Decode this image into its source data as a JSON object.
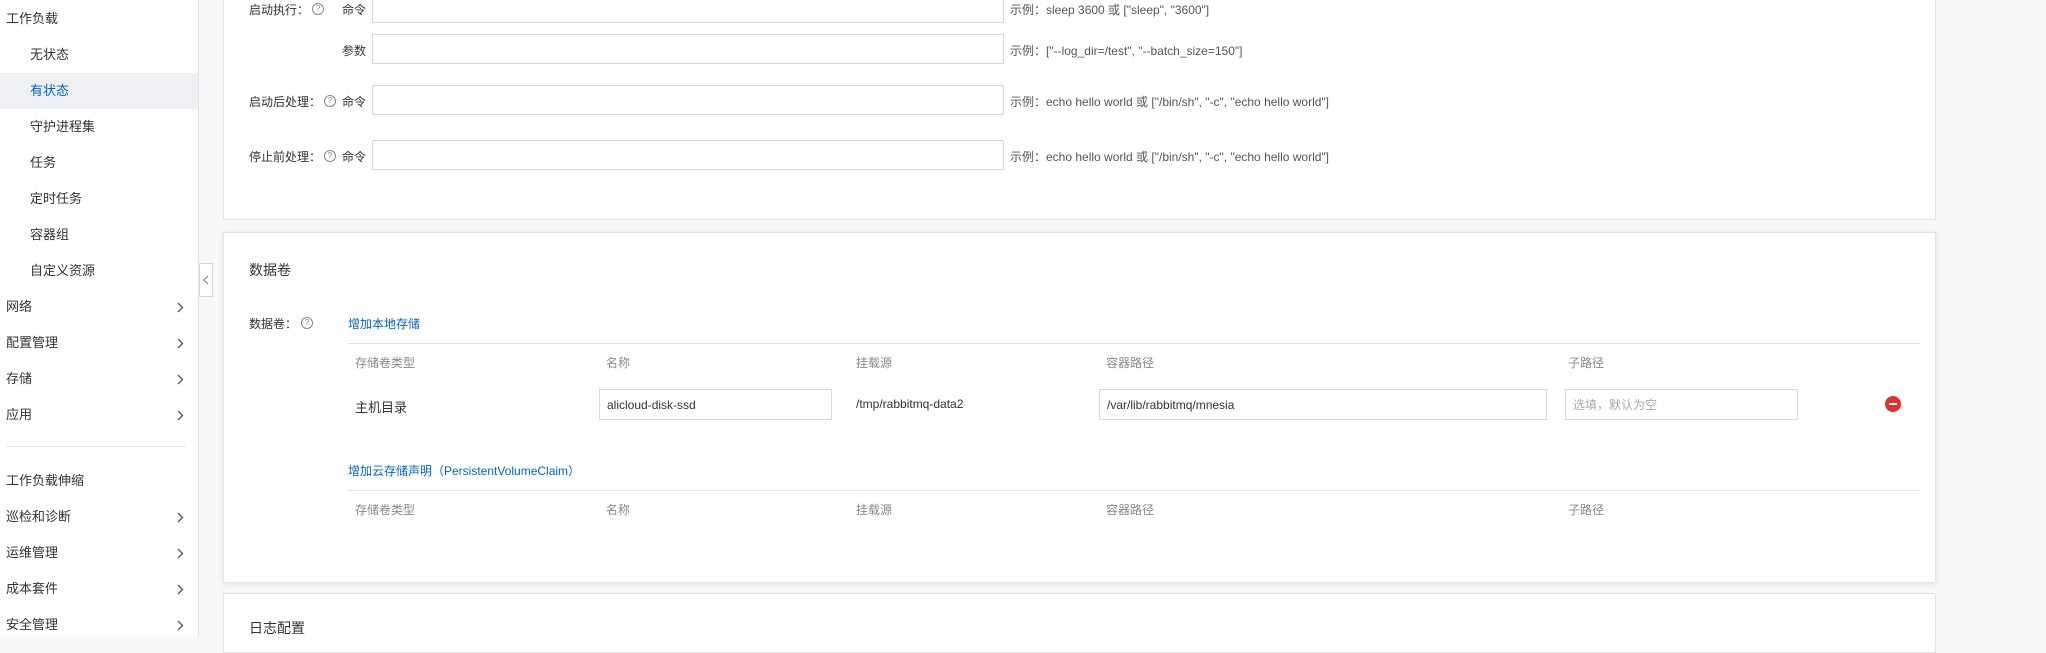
{
  "sidebar": {
    "items": [
      {
        "label": "工作负载"
      },
      {
        "label": "无状态"
      },
      {
        "label": "有状态"
      },
      {
        "label": "守护进程集"
      },
      {
        "label": "任务"
      },
      {
        "label": "定时任务"
      },
      {
        "label": "容器组"
      },
      {
        "label": "自定义资源"
      },
      {
        "label": "网络"
      },
      {
        "label": "配置管理"
      },
      {
        "label": "存储"
      },
      {
        "label": "应用"
      },
      {
        "label": "工作负载伸缩"
      },
      {
        "label": "巡检和诊断"
      },
      {
        "label": "运维管理"
      },
      {
        "label": "成本套件"
      },
      {
        "label": "安全管理"
      }
    ]
  },
  "lifecycle": {
    "startup": {
      "label": "启动执行：",
      "command_label": "命令",
      "command_value": "",
      "command_hint": "示例：sleep 3600 或 [\"sleep\", \"3600\"]",
      "args_label": "参数",
      "args_value": "",
      "args_hint": "示例：[\"--log_dir=/test\", \"--batch_size=150\"]"
    },
    "post_start": {
      "label": "启动后处理：",
      "command_label": "命令",
      "command_value": "",
      "command_hint": "示例：echo hello world 或 [\"/bin/sh\", \"-c\", \"echo hello world\"]"
    },
    "pre_stop": {
      "label": "停止前处理：",
      "command_label": "命令",
      "command_value": "",
      "command_hint": "示例：echo hello world 或 [\"/bin/sh\", \"-c\", \"echo hello world\"]"
    }
  },
  "volumes": {
    "section_title": "数据卷",
    "field_label": "数据卷：",
    "add_local_link": "增加本地存储",
    "headers": [
      "存储卷类型",
      "名称",
      "挂载源",
      "容器路径",
      "子路径"
    ],
    "local_rows": [
      {
        "type": "主机目录",
        "name": "alicloud-disk-ssd",
        "source": "/tmp/rabbitmq-data2",
        "container_path": "/var/lib/rabbitmq/mnesia",
        "sub_path": "",
        "sub_path_placeholder": "选填，默认为空"
      }
    ],
    "add_pvc_link": "增加云存储声明（PersistentVolumeClaim）",
    "pvc_headers": [
      "存储卷类型",
      "名称",
      "挂载源",
      "容器路径",
      "子路径"
    ]
  },
  "log_config": {
    "section_title": "日志配置"
  },
  "colors": {
    "accent": "#0064c8",
    "danger": "#e0312c"
  }
}
